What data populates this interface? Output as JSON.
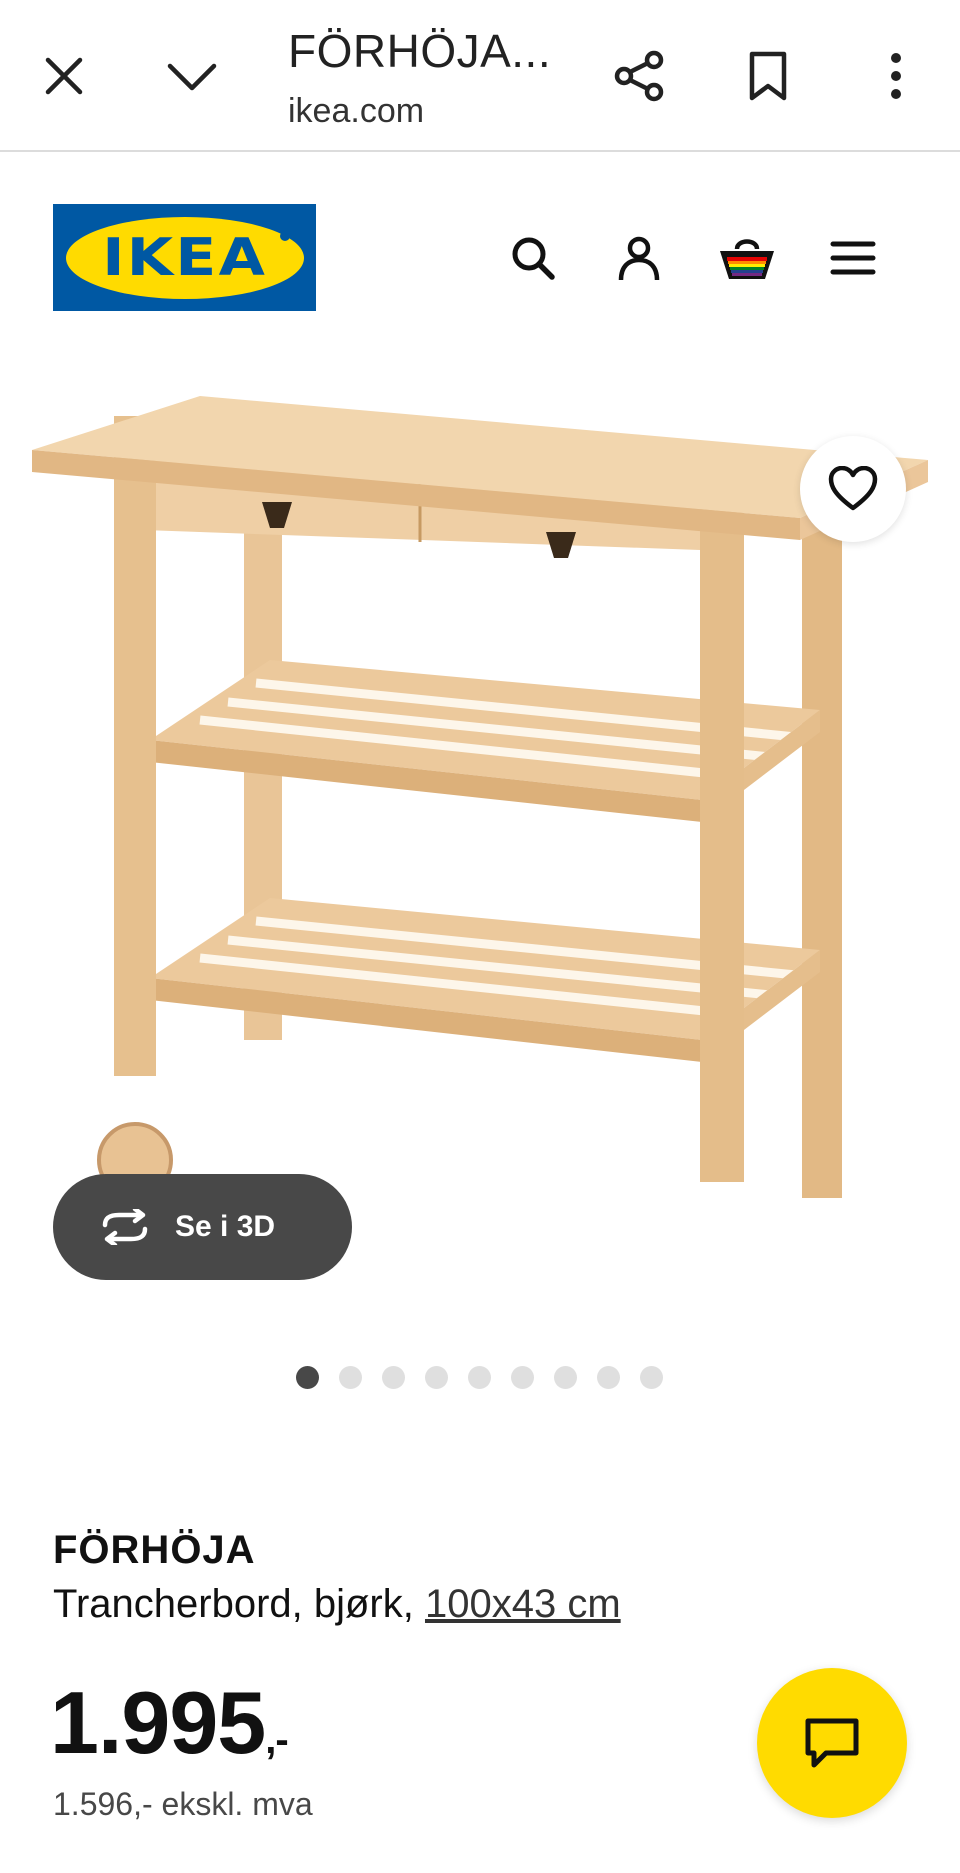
{
  "browser": {
    "title": "FÖRHÖJA...",
    "url": "ikea.com",
    "icons": [
      "close-icon",
      "chevron-down-icon",
      "share-icon",
      "bookmark-icon",
      "more-vert-icon"
    ]
  },
  "header": {
    "logo_text": "IKEA",
    "icons": [
      "search-icon",
      "account-icon",
      "basket-icon",
      "menu-icon"
    ]
  },
  "gallery": {
    "view3d_label": "Se i 3D",
    "dot_count": 9,
    "active_dot": 0
  },
  "product": {
    "name": "FÖRHÖJA",
    "description": "Trancherbord, bjørk, ",
    "size": "100x43 cm",
    "price": "1.995",
    "price_suffix": ",-",
    "price_ex_vat": "1.596,- ekskl. mva"
  },
  "colors": {
    "ikea_blue": "#0058a3",
    "ikea_yellow": "#ffdb00",
    "dark_button": "#484848",
    "wood": "#e9c597"
  }
}
